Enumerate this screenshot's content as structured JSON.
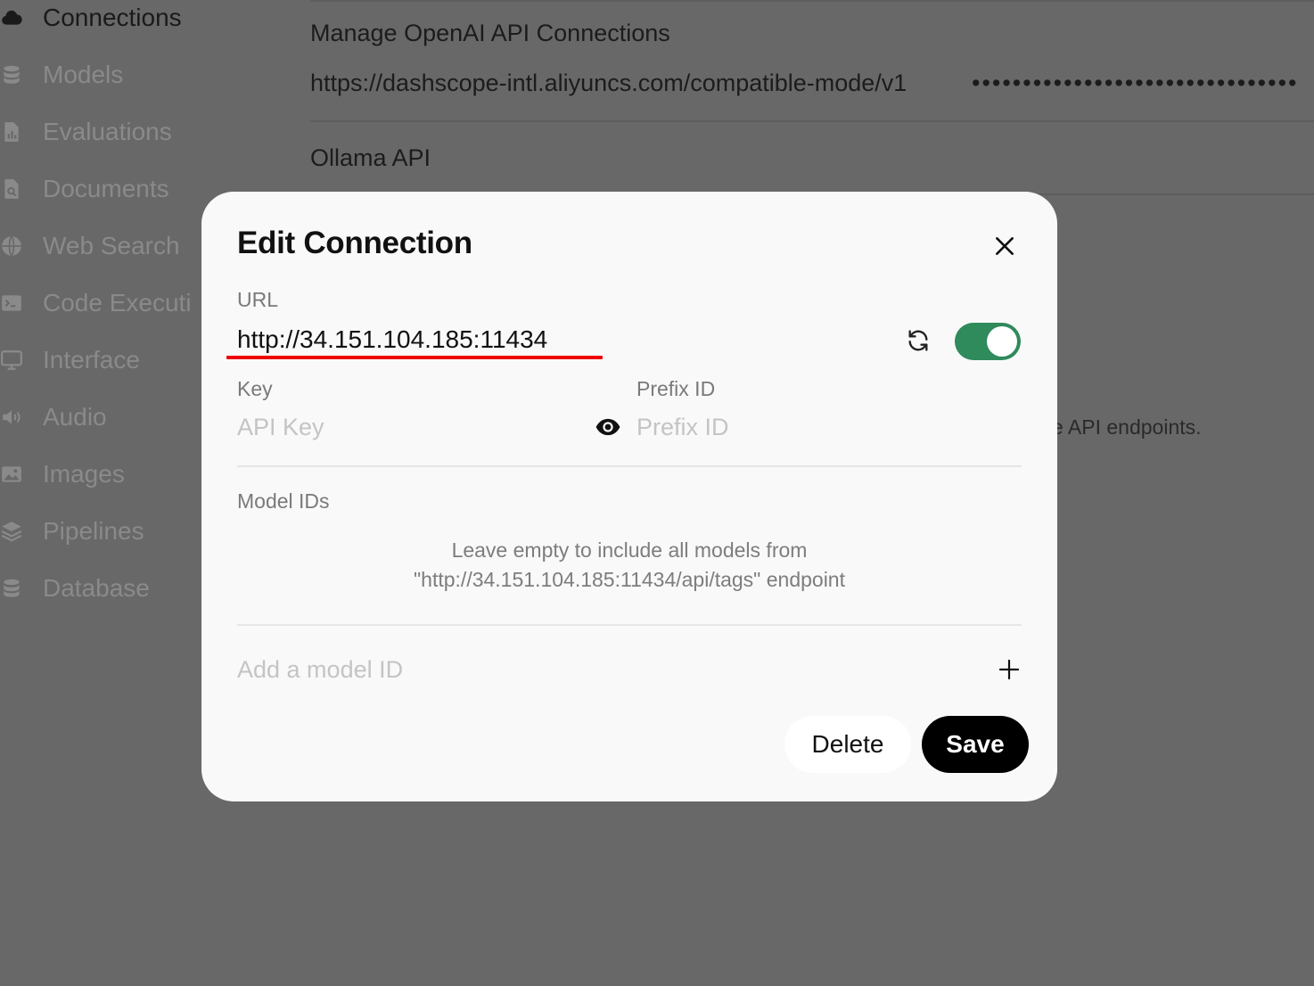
{
  "sidebar": {
    "items": [
      {
        "label": "Connections",
        "icon": "cloud-icon",
        "active": true
      },
      {
        "label": "Models",
        "icon": "database-icon"
      },
      {
        "label": "Evaluations",
        "icon": "document-chart-icon"
      },
      {
        "label": "Documents",
        "icon": "document-search-icon"
      },
      {
        "label": "Web Search",
        "icon": "globe-icon"
      },
      {
        "label": "Code Executi",
        "icon": "terminal-icon"
      },
      {
        "label": "Interface",
        "icon": "monitor-icon"
      },
      {
        "label": "Audio",
        "icon": "speaker-icon"
      },
      {
        "label": "Images",
        "icon": "image-icon"
      },
      {
        "label": "Pipelines",
        "icon": "layers-icon"
      },
      {
        "label": "Database",
        "icon": "database-icon"
      }
    ]
  },
  "background": {
    "openai_heading": "Manage OpenAI API Connections",
    "openai_url": "https://dashscope-intl.aliyuncs.com/compatible-mode/v1",
    "openai_key_mask": "••••••••••••••••••••••••••••••••",
    "ollama_heading": "Ollama API",
    "desc_fragment": "e API endpoints."
  },
  "modal": {
    "title": "Edit Connection",
    "url_label": "URL",
    "url_value": "http://34.151.104.185:11434",
    "toggle_enabled": true,
    "key_label": "Key",
    "key_placeholder": "API Key",
    "prefix_label": "Prefix ID",
    "prefix_placeholder": "Prefix ID",
    "model_ids_label": "Model IDs",
    "helper_line1": "Leave empty to include all models from",
    "helper_line2": "\"http://34.151.104.185:11434/api/tags\" endpoint",
    "add_model_placeholder": "Add a model ID",
    "delete_label": "Delete",
    "save_label": "Save"
  },
  "colors": {
    "overlay": "#686868",
    "toggle_on": "#2f8a5c",
    "highlight_underline": "#ee0000"
  }
}
